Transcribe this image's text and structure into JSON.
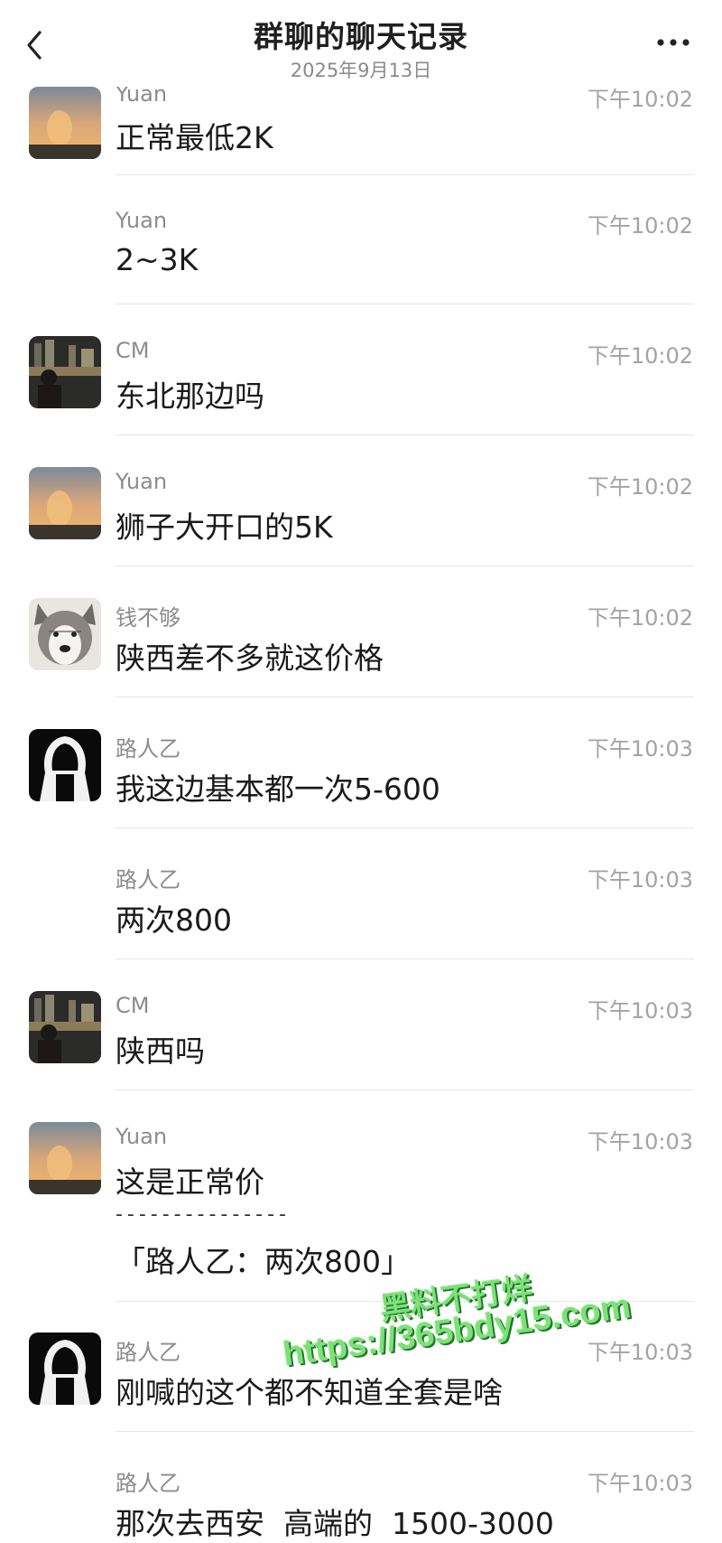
{
  "header": {
    "title": "群聊的聊天记录",
    "date": "2025年9月13日"
  },
  "messages": [
    {
      "name": "Yuan",
      "time": "下午10:02",
      "text": "正常最低2K",
      "avatar": "sunset-avatar"
    },
    {
      "name": "Yuan",
      "time": "下午10:02",
      "text": "2~3K",
      "avatar": ""
    },
    {
      "name": "CM",
      "time": "下午10:02",
      "text": "东北那边吗",
      "avatar": "city-night-avatar"
    },
    {
      "name": "Yuan",
      "time": "下午10:02",
      "text": "狮子大开口的5K",
      "avatar": "sunset-avatar"
    },
    {
      "name": "钱不够",
      "time": "下午10:02",
      "text": "陕西差不多就这价格",
      "avatar": "husky-avatar"
    },
    {
      "name": "路人乙",
      "time": "下午10:03",
      "text": "我这边基本都一次5-600",
      "avatar": "hooded-figure-avatar"
    },
    {
      "name": "路人乙",
      "time": "下午10:03",
      "text": "两次800",
      "avatar": ""
    },
    {
      "name": "CM",
      "time": "下午10:03",
      "text": "陕西吗",
      "avatar": "city-night-avatar"
    },
    {
      "name": "Yuan",
      "time": "下午10:03",
      "text": "这是正常价",
      "quote_separator": "- - - - - - - - - - - - - - -",
      "quote": "「路人乙：两次800」",
      "avatar": "sunset-avatar"
    },
    {
      "name": "路人乙",
      "time": "下午10:03",
      "text": "刚喊的这个都不知道全套是啥",
      "avatar": "hooded-figure-avatar"
    },
    {
      "name": "路人乙",
      "time": "下午10:03",
      "text": "那次去西安  高端的  1500-3000",
      "avatar": ""
    }
  ],
  "watermark": {
    "line1": "黑料不打烊",
    "line2": "https://365bdy15.com"
  },
  "colors": {
    "name": "#8c8c8c",
    "time": "#a3a3a3",
    "text": "#1a1a1a",
    "divider": "#e6e6e6",
    "watermark": "#7fe07a"
  }
}
